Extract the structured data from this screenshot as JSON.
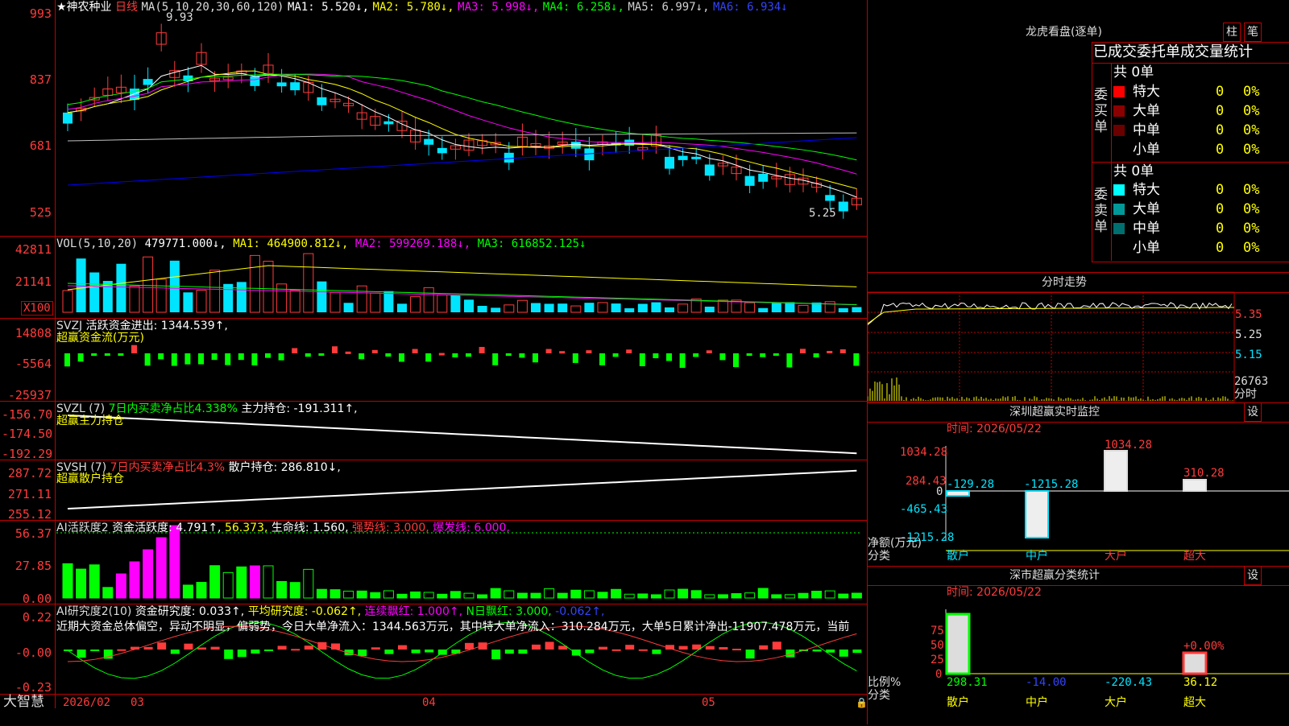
{
  "main_chart": {
    "star_title": "★神农种业",
    "period": "日线",
    "ma_header": "MA(5,10,20,30,60,120)",
    "ma1": "MA1: 5.520↓,",
    "ma2": "MA2: 5.780↓,",
    "ma3": "MA3: 5.998↓,",
    "ma4": "MA4: 6.258↓,",
    "ma5": "MA5: 6.997↓,",
    "ma6": "MA6: 6.934↓",
    "high_mark": "9.93",
    "low_mark": "5.25",
    "y_labels": [
      "993",
      "837",
      "681",
      "525"
    ],
    "colors": {
      "up": "#ff3b3b",
      "down": "#00e5ff",
      "ma1": "#ffffff",
      "ma2": "#ffff00",
      "ma3": "#ff00ff",
      "ma4": "#00ff00",
      "ma5": "#c0c0c0",
      "ma6": "#0000ff"
    }
  },
  "vol_panel": {
    "header": "VOL(5,10,20)",
    "value": "479771.000↓,",
    "ma1": "MA1: 464900.812↓,",
    "ma2": "MA2: 599269.188↓,",
    "ma3": "MA3: 616852.125↓",
    "y_labels": [
      "42811",
      "21141"
    ],
    "unit": "X100"
  },
  "svzj_panel": {
    "header": "SVZJ",
    "text": "活跃资金进出: 1344.539↑,",
    "subtitle": "超赢资金流(万元)",
    "y_labels": [
      "14808",
      "-5564",
      "-25937"
    ]
  },
  "svzl_panel": {
    "header": "SVZL (7)",
    "ratio": "7日内买卖净占比4.338%",
    "main_hold": "主力持仓: -191.311↑,",
    "subtitle": "超赢主力持仓",
    "y_labels": [
      "-156.70",
      "-174.50",
      "-192.29"
    ]
  },
  "svsh_panel": {
    "header": "SVSH (7)",
    "ratio": "7日内买卖净占比4.3%",
    "retail_hold": "散户持仓: 286.810↓,",
    "subtitle": "超赢散户持仓",
    "y_labels": [
      "287.72",
      "271.11",
      "255.12"
    ]
  },
  "ai_active_panel": {
    "header": "AI活跃度2",
    "active": "资金活跃度: 4.791↑,",
    "val2": "56.373,",
    "life": "生命线: 1.560,",
    "strong": "强势线: 3.000,",
    "burst": "爆发线: 6.000,",
    "y_labels": [
      "56.37",
      "27.85",
      "0.00"
    ]
  },
  "ai_research_panel": {
    "header": "AI研究度2(10)",
    "research": "资金研究度: 0.033↑,",
    "avg": "平均研究度: -0.062↑,",
    "cont": "连续飘红: 1.000↑,",
    "nday": "N日飘红: 3.000,",
    "last": "-0.062↑,",
    "summary": "近期大资金总体偏空，异动不明显，偏弱势，今日大单净流入：1344.563万元，其中特大单净流入：310.284万元，大单5日累计净出-11907.478万元，当前",
    "y_labels": [
      "0.22",
      "-0.00",
      "-0.23"
    ]
  },
  "x_axis": {
    "brand": "大智慧",
    "labels": [
      "2026/02",
      "03",
      "04",
      "05"
    ]
  },
  "right_panel": {
    "title": "龙虎看盘(逐单)",
    "btn_bar": "柱",
    "btn_pen": "笔",
    "table_title": "已成交委托单成交量统计",
    "buy_label": "委买单",
    "sell_label": "委卖单",
    "buy_total": "共 0单",
    "sell_total": "共 0单",
    "buy_rows": [
      {
        "name": "特大",
        "count": "0",
        "pct": "0%",
        "color": "#ff0000"
      },
      {
        "name": "大单",
        "count": "0",
        "pct": "0%",
        "color": "#8b0000"
      },
      {
        "name": "中单",
        "count": "0",
        "pct": "0%",
        "color": "#6b0000"
      },
      {
        "name": "小单",
        "count": "0",
        "pct": "0%",
        "color": "#000000"
      }
    ],
    "sell_rows": [
      {
        "name": "特大",
        "count": "0",
        "pct": "0%",
        "color": "#00ffff"
      },
      {
        "name": "大单",
        "count": "0",
        "pct": "0%",
        "color": "#009999"
      },
      {
        "name": "中单",
        "count": "0",
        "pct": "0%",
        "color": "#006f6f"
      },
      {
        "name": "小单",
        "count": "0",
        "pct": "0%",
        "color": "#000000"
      }
    ],
    "intraday": {
      "title": "分时走势",
      "y_labels": [
        "5.35",
        "5.25",
        "5.15"
      ],
      "vol_label": "26763",
      "vol_unit": "分时"
    },
    "sz_monitor": {
      "title": "深圳超赢实时监控",
      "btn": "设",
      "time": "时间: 2026/05/22",
      "y_labels": [
        "1034.28",
        "284.43",
        "0",
        "-465.43",
        "-1215.28"
      ],
      "unit": "净额(万元)",
      "cat_label": "分类",
      "bars": [
        {
          "name": "散户",
          "value": "-129.28"
        },
        {
          "name": "中户",
          "value": "-1215.28"
        },
        {
          "name": "大户",
          "value": "1034.28"
        },
        {
          "name": "超大",
          "value": "310.28"
        }
      ]
    },
    "sz_classify": {
      "title": "深市超赢分类统计",
      "btn": "设",
      "time": "时间: 2026/05/22",
      "y_labels": [
        "75",
        "50",
        "25",
        "0"
      ],
      "unit": "比例%",
      "cat_label": "分类",
      "pct_note": "+0.00%",
      "bars": [
        {
          "name": "散户",
          "value": "298.31"
        },
        {
          "name": "中户",
          "value": "-14.00"
        },
        {
          "name": "大户",
          "value": "-220.43"
        },
        {
          "name": "超大",
          "value": "36.12"
        }
      ]
    }
  }
}
